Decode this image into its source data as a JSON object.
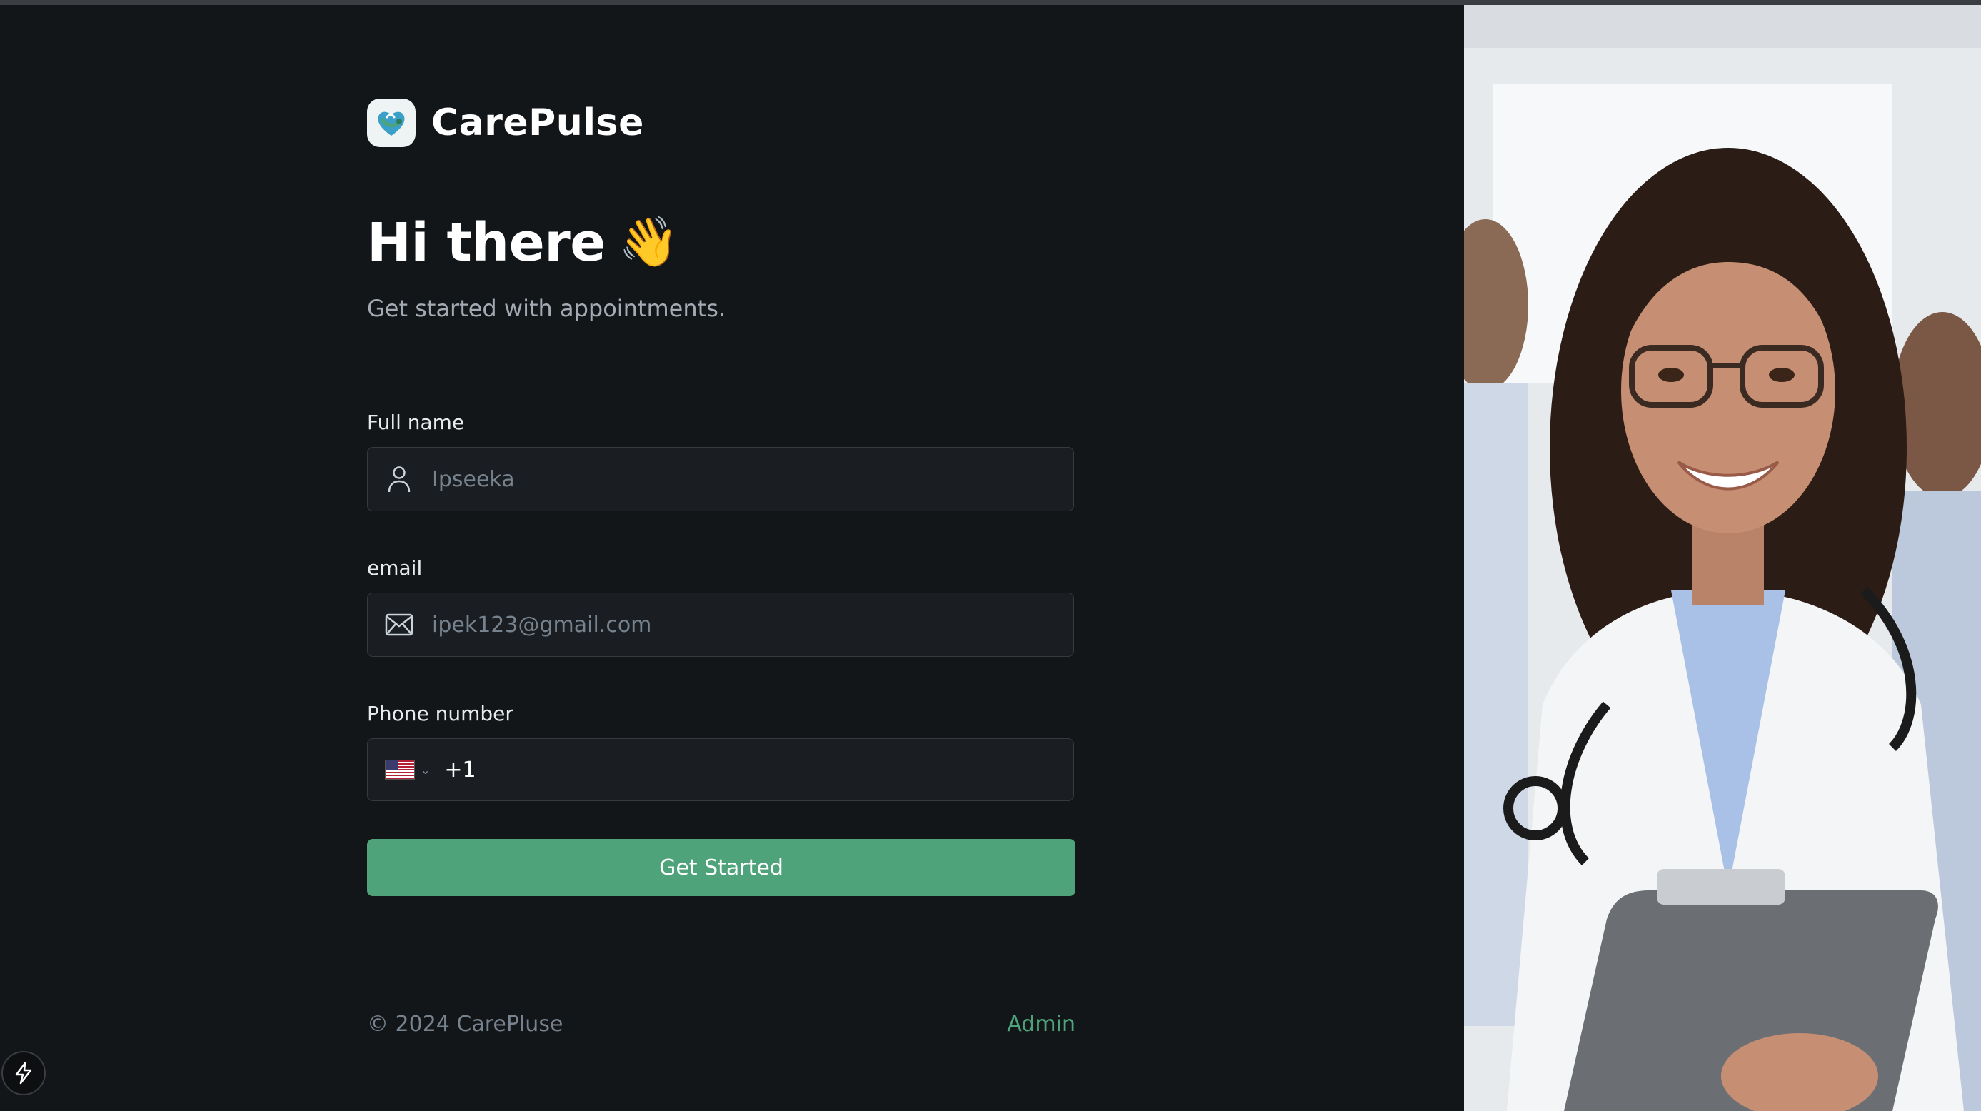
{
  "app": {
    "brand_name": "CarePulse",
    "logo_icon": "heart-stethoscope-icon"
  },
  "hero": {
    "title": "Hi there",
    "emoji": "👋",
    "subtitle": "Get started with appointments."
  },
  "form": {
    "full_name": {
      "label": "Full name",
      "placeholder": "Ipseeka",
      "icon": "user-icon"
    },
    "email": {
      "label": "email",
      "placeholder": "ipek123@gmail.com",
      "icon": "mail-icon"
    },
    "phone": {
      "label": "Phone number",
      "country_flag": "us-flag-icon",
      "dial_code": "+1",
      "value": ""
    },
    "submit_label": "Get Started"
  },
  "footer": {
    "copyright": "© 2024 CarePluse",
    "admin_link": "Admin"
  },
  "colors": {
    "background": "#131619",
    "accent": "#4fa37a",
    "input_bg": "#1a1d21",
    "input_border": "#363a3d"
  }
}
